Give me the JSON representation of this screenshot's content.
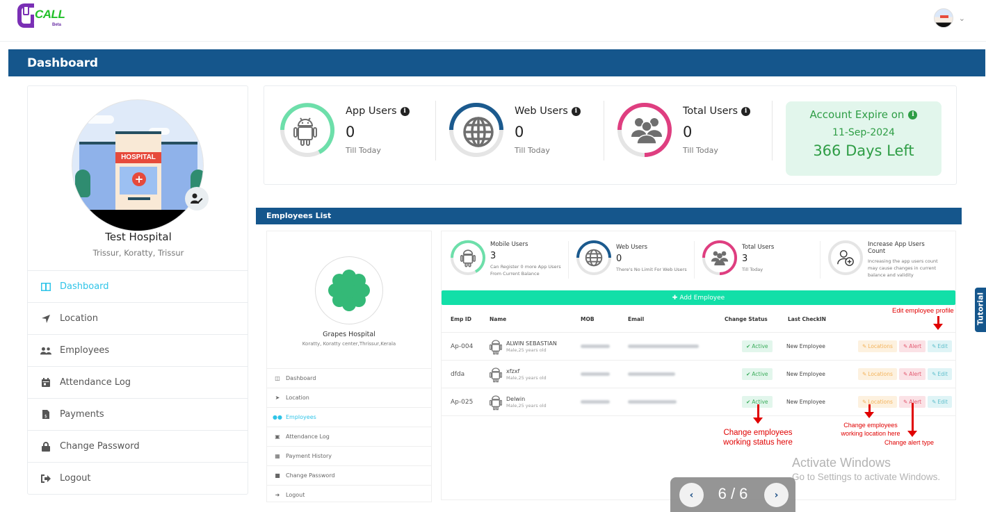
{
  "app": {
    "logo_text": "CALL",
    "logo_badge": "Beta"
  },
  "header": {
    "title": "Dashboard"
  },
  "profile": {
    "name": "Test Hospital",
    "location": "Trissur, Koratty, Trissur",
    "avatar_sign": "HOSPITAL"
  },
  "sidebar": {
    "items": [
      {
        "label": "Dashboard",
        "icon": "columns-icon",
        "active": true
      },
      {
        "label": "Location",
        "icon": "location-arrow-icon"
      },
      {
        "label": "Employees",
        "icon": "users-icon"
      },
      {
        "label": "Attendance Log",
        "icon": "calendar-icon"
      },
      {
        "label": "Payments",
        "icon": "invoice-dollar-icon"
      },
      {
        "label": "Change Password",
        "icon": "lock-icon"
      },
      {
        "label": "Logout",
        "icon": "sign-out-icon"
      }
    ]
  },
  "stats": {
    "app_users": {
      "label": "App Users",
      "value": "0",
      "sub": "Till Today",
      "color": "#6ddfaa"
    },
    "web_users": {
      "label": "Web Users",
      "value": "0",
      "sub": "Till Today",
      "color": "#1b5a8e"
    },
    "total_users": {
      "label": "Total Users",
      "value": "0",
      "sub": "Till Today",
      "color": "#df3e80"
    },
    "expire": {
      "label": "Account Expire on",
      "date": "11-Sep-2024",
      "days_left": "366 Days Left"
    }
  },
  "tutorial_slide": {
    "section_title": "Employees List",
    "org": {
      "name": "Grapes Hospital",
      "location": "Koratty, Koratty center,Thrissur,Kerala"
    },
    "nav": [
      {
        "label": "Dashboard"
      },
      {
        "label": "Location"
      },
      {
        "label": "Employees",
        "active": true
      },
      {
        "label": "Attendance Log"
      },
      {
        "label": "Payment History"
      },
      {
        "label": "Change Password"
      },
      {
        "label": "Logout"
      }
    ],
    "stats": {
      "mobile": {
        "label": "Mobile Users",
        "value": "3",
        "sub": "Can Register 0 more App Users From Current Balance"
      },
      "web": {
        "label": "Web Users",
        "value": "0",
        "sub": "There's No Limit For Web Users"
      },
      "total": {
        "label": "Total Users",
        "value": "3",
        "sub": "Till Today"
      },
      "increase": {
        "label": "Increase App Users Count",
        "sub": "Increasing the app users count may cause changes in current balance and validity"
      }
    },
    "add_button": "Add Employee",
    "table": {
      "columns": [
        "Emp ID",
        "Name",
        "MOB",
        "Email",
        "Change Status",
        "Last CheckIN"
      ],
      "rows": [
        {
          "id": "Ap-004",
          "name": "ALWIN SEBASTIAN",
          "meta": "Male,25 years old",
          "status": "Active",
          "checkin": "New Employee"
        },
        {
          "id": "dfda",
          "name": "xfzxf",
          "meta": "Male,25 years old",
          "status": "Active",
          "checkin": "New Employee"
        },
        {
          "id": "Ap-025",
          "name": "Delwin",
          "meta": "Male,25 years old",
          "status": "Active",
          "checkin": "New Employee"
        }
      ],
      "actions": {
        "locations": "Locations",
        "alert": "Alert",
        "edit": "Edit"
      }
    },
    "annotations": {
      "edit": "Edit employee profile",
      "status": "Change employees working status here",
      "location": "Change employees working location here",
      "alert": "Change alert type"
    }
  },
  "tutorial_tab": "Tutorial",
  "pager": {
    "current": 6,
    "total": 6,
    "text": "6 / 6"
  },
  "watermark": {
    "title": "Activate Windows",
    "subtitle": "Go to Settings to activate Windows."
  }
}
